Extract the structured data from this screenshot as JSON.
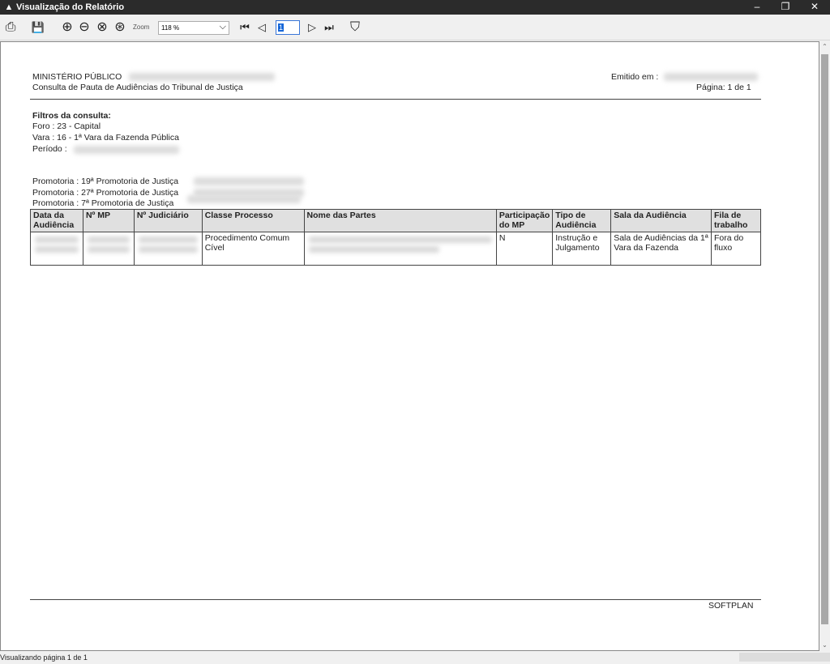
{
  "window": {
    "title": "Visualização do Relatório",
    "minimize": "–",
    "restore": "❐",
    "close": "✕"
  },
  "toolbar": {
    "print": "⎙",
    "save": "💾",
    "zoom_in": "⊕",
    "zoom_out": "⊖",
    "zoom_fit": "⊗",
    "zoom_page": "⊛",
    "zoom_label": "Zoom",
    "zoom_value": "118 %",
    "zoom_chevron": "⌵",
    "first_page": "⏮",
    "prev_page": "◁",
    "page_value": "1",
    "next_page": "▷",
    "last_page": "⏭",
    "filter": "⛉"
  },
  "report": {
    "org": "MINISTÉRIO PÚBLICO",
    "subtitle": "Consulta de Pauta de Audiências do Tribunal de Justiça",
    "emitted_label": "Emitido em :",
    "page_label": "Página: 1 de 1",
    "filters_title": "Filtros da consulta:",
    "foro": "Foro : 23 - Capital",
    "vara": "Vara : 16 - 1ª Vara da Fazenda Pública",
    "periodo": "Período :",
    "promotorias": [
      "Promotoria : 19ª Promotoria de Justiça",
      "Promotoria : 27ª Promotoria de Justiça",
      "Promotoria : 7ª Promotoria de Justiça"
    ],
    "table": {
      "headers": [
        "Data da Audiência",
        "Nº MP",
        "Nº Judiciário",
        "Classe Processo",
        "Nome das Partes",
        "Participação do MP",
        "Tipo de Audiência",
        "Sala da Audiência",
        "Fila de trabalho"
      ],
      "row": {
        "classe": "Procedimento Comum Cível",
        "participacao": "N",
        "tipo": "Instrução e Julgamento",
        "sala": "Sala de Audiências da 1ª Vara da Fazenda",
        "fila": "Fora do fluxo"
      }
    },
    "footer": "SOFTPLAN"
  },
  "scrollbar": {
    "up": "⌃",
    "down": "⌄"
  },
  "status": {
    "text": "Visualizando página 1 de 1"
  }
}
